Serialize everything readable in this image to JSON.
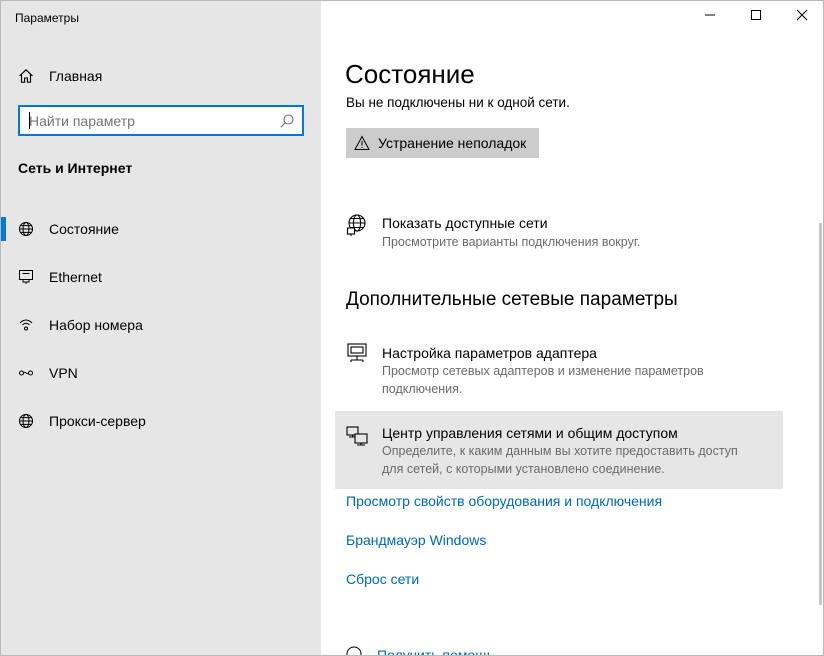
{
  "window": {
    "title": "Параметры",
    "controls": {
      "minimize": "minimize",
      "maximize": "maximize",
      "close": "close"
    }
  },
  "sidebar": {
    "home_label": "Главная",
    "search_placeholder": "Найти параметр",
    "section_title": "Сеть и Интернет",
    "items": [
      {
        "label": "Состояние",
        "icon": "globe-icon",
        "selected": true
      },
      {
        "label": "Ethernet",
        "icon": "ethernet-icon",
        "selected": false
      },
      {
        "label": "Набор номера",
        "icon": "dialup-icon",
        "selected": false
      },
      {
        "label": "VPN",
        "icon": "vpn-icon",
        "selected": false
      },
      {
        "label": "Прокси-сервер",
        "icon": "globe-icon",
        "selected": false
      }
    ]
  },
  "main": {
    "title": "Состояние",
    "status_text": "Вы не подключены ни к одной сети.",
    "troubleshoot_label": "Устранение неполадок",
    "show_networks": {
      "title": "Показать доступные сети",
      "desc": "Просмотрите варианты подключения вокруг."
    },
    "advanced_title": "Дополнительные сетевые параметры",
    "adapter_options": {
      "title": "Настройка параметров адаптера",
      "desc": "Просмотр сетевых адаптеров и изменение параметров подключения."
    },
    "sharing_center": {
      "title": "Центр управления сетями и общим доступом",
      "desc": "Определите, к каким данным вы хотите предоставить доступ для сетей, с которыми установлено соединение."
    },
    "links": [
      "Просмотр свойств оборудования и подключения",
      "Брандмауэр Windows",
      "Сброс сети"
    ],
    "help_link": "Получить помощь"
  },
  "colors": {
    "accent": "#0078d7",
    "link": "#0067b8",
    "sidebar_bg": "#e6e6e6",
    "button_bg": "#cccccc"
  }
}
